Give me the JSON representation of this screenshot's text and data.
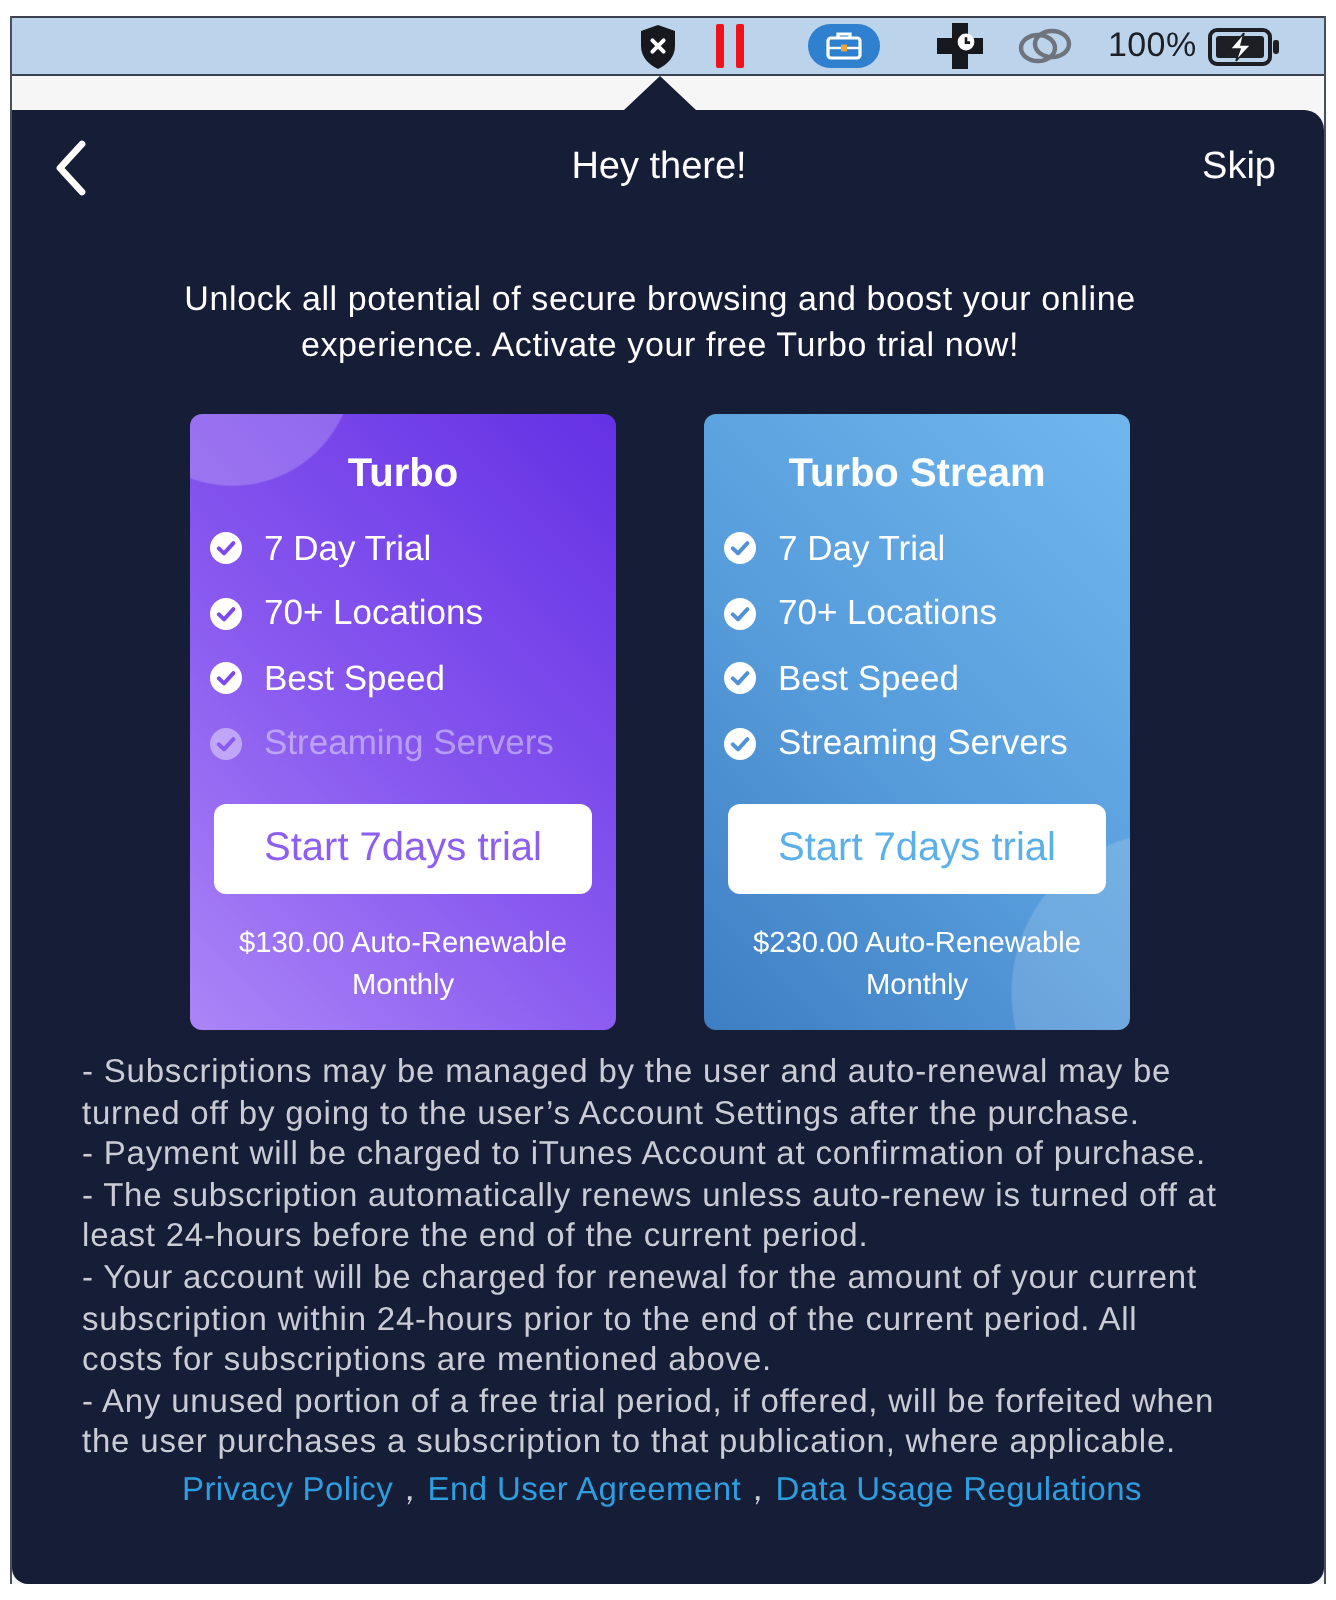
{
  "menu_bar": {
    "battery_percent": "100%"
  },
  "header": {
    "title": "Hey there!",
    "skip": "Skip"
  },
  "intro": "Unlock all potential of secure browsing and boost your online experience. Activate your free Turbo trial now!",
  "plans": [
    {
      "kind": "violet",
      "name": "Turbo",
      "features": [
        {
          "text": "7 Day Trial",
          "included": true
        },
        {
          "text": "70+ Locations",
          "included": true
        },
        {
          "text": "Best Speed",
          "included": true
        },
        {
          "text": "Streaming Servers",
          "included": false
        }
      ],
      "button": "Start 7days trial",
      "price": "$130.00 Auto-Renewable Monthly"
    },
    {
      "kind": "azure",
      "name": "Turbo Stream",
      "features": [
        {
          "text": "7 Day Trial",
          "included": true
        },
        {
          "text": "70+ Locations",
          "included": true
        },
        {
          "text": "Best Speed",
          "included": true
        },
        {
          "text": "Streaming Servers",
          "included": true
        }
      ],
      "button": "Start 7days trial",
      "price": "$230.00 Auto-Renewable Monthly"
    }
  ],
  "terms": [
    "- Subscriptions may be managed by the user and auto-renewal may be turned off by going to the user’s Account Settings after the purchase.",
    "- Payment will be charged to iTunes Account at confirmation of purchase.",
    "- The subscription automatically renews unless auto-renew is turned off at least 24-hours before the end of the current period.",
    "- Your account will be charged for renewal for the amount of your current subscription within 24-hours prior to the end of the current period. All costs for subscriptions are mentioned above.",
    "- Any unused portion of a free trial period, if offered, will be forfeited when the user purchases a subscription to that publication, where applicable."
  ],
  "footer_links": [
    {
      "kind": "link",
      "text": "Privacy Policy"
    },
    {
      "kind": "separator",
      "text": "，"
    },
    {
      "kind": "link",
      "text": "End User Agreement"
    },
    {
      "kind": "separator",
      "text": "，"
    },
    {
      "kind": "link",
      "text": "Data Usage Regulations"
    }
  ]
}
